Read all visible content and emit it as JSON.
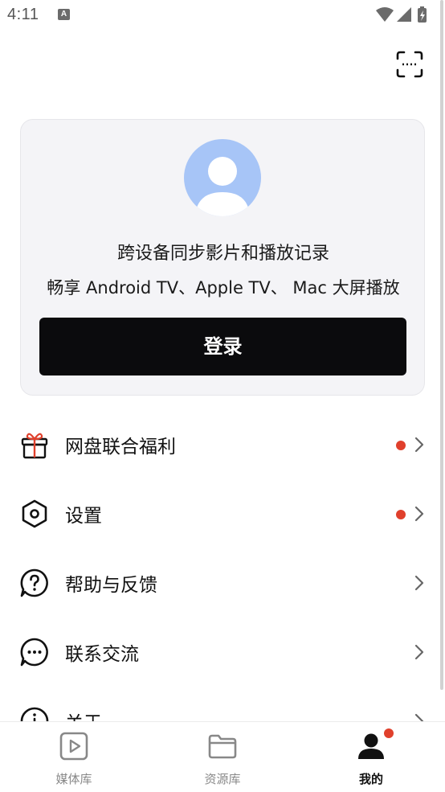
{
  "status_bar": {
    "time": "4:11",
    "notification_badge": "A"
  },
  "top": {
    "scan_icon": "scan-icon"
  },
  "profile_card": {
    "title": "跨设备同步影片和播放记录",
    "subtitle": "畅享 Android TV、Apple TV、 Mac 大屏播放",
    "login_label": "登录",
    "avatar_color": "#a7c5f7"
  },
  "menu": [
    {
      "label": "网盘联合福利",
      "icon": "gift-icon",
      "has_dot": true
    },
    {
      "label": "设置",
      "icon": "settings-icon",
      "has_dot": true
    },
    {
      "label": "帮助与反馈",
      "icon": "help-icon",
      "has_dot": false
    },
    {
      "label": "联系交流",
      "icon": "chat-icon",
      "has_dot": false
    },
    {
      "label": "关于",
      "icon": "info-icon",
      "has_dot": false
    }
  ],
  "bottom_nav": {
    "items": [
      {
        "label": "媒体库",
        "icon": "play-icon",
        "active": false
      },
      {
        "label": "资源库",
        "icon": "folder-icon",
        "active": false
      },
      {
        "label": "我的",
        "icon": "person-icon",
        "active": true
      }
    ]
  },
  "colors": {
    "accent_dot": "#e0402c",
    "button_bg": "#0b0b0d",
    "card_bg": "#f4f4f7"
  }
}
